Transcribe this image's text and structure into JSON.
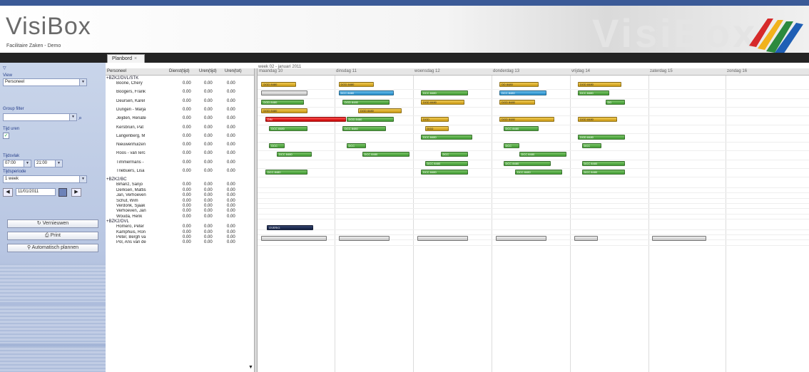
{
  "app": {
    "name": "VisiBox",
    "subtitle": "Facilitaire Zaken - Demo",
    "watermark": "VisiBox",
    "accent_color": "#3b5a97"
  },
  "tabs": [
    {
      "label": "Planbord",
      "close_icon": "close-icon"
    }
  ],
  "sidebar": {
    "view_label": "View",
    "view_value": "Personeel",
    "group_filter_label": "Group filter",
    "group_filter_value": "",
    "time_label": "Tijd uren",
    "time_range_label": "Tijdsvlak",
    "time_from": "07:00",
    "time_to": "21:00",
    "period_label": "Tijdsperiode",
    "period_value": "1 week",
    "date_value": "11/01/2011",
    "buttons": {
      "refresh": "Vernieuwen",
      "print": "Print",
      "auto_plan": "Automatisch plannen"
    }
  },
  "grid": {
    "week_title": "week 02 - januari 2011",
    "columns": [
      "Personeel",
      "Dienst(tijd)",
      "Uren(tijd)",
      "Uren(tot)"
    ],
    "days": [
      "maandag 10",
      "dinsdag 11",
      "woensdag 12",
      "donderdag 13",
      "vrijdag 14",
      "zaterdag 15",
      "zondag 16"
    ],
    "groups": [
      {
        "name": "BZK2/DVL/STK",
        "rows": [
          {
            "name": "Boone, Chery",
            "v": [
              "0.00",
              "0.00",
              "0.00"
            ]
          },
          {
            "name": "Boogers, Frank",
            "v": [
              "0.00",
              "0.00",
              "0.00"
            ]
          },
          {
            "name": "Deursen, Karel",
            "v": [
              "0.00",
              "0.00",
              "0.00"
            ]
          },
          {
            "name": "Dungen - Marja",
            "v": [
              "0.00",
              "0.00",
              "0.00"
            ]
          },
          {
            "name": "Jeijden, Renate",
            "v": [
              "0.00",
              "0.00",
              "0.00"
            ]
          },
          {
            "name": "Kersbruin, Pat",
            "v": [
              "0.00",
              "0.00",
              "0.00"
            ]
          },
          {
            "name": "Langenberg, M",
            "v": [
              "0.00",
              "0.00",
              "0.00"
            ]
          },
          {
            "name": "Nieuwenhuizen",
            "v": [
              "0.00",
              "0.00",
              "0.00"
            ]
          },
          {
            "name": "Roos - van Ierc",
            "v": [
              "0.00",
              "0.00",
              "0.00"
            ]
          },
          {
            "name": "Timmermans -",
            "v": [
              "0.00",
              "0.00",
              "0.00"
            ]
          },
          {
            "name": "Triebuers, Lisa",
            "v": [
              "0.00",
              "0.00",
              "0.00"
            ]
          }
        ]
      },
      {
        "name": "BZK2/BC",
        "rows": [
          {
            "name": "Bihariz, Sanjo",
            "v": [
              "0.00",
              "0.00",
              "0.00"
            ]
          },
          {
            "name": "Derksen, Mattis",
            "v": [
              "0.00",
              "0.00",
              "0.00"
            ]
          },
          {
            "name": "Jan, Verhoeven",
            "v": [
              "0.00",
              "0.00",
              "0.00"
            ]
          },
          {
            "name": "Schut, Wim",
            "v": [
              "0.00",
              "0.00",
              "0.00"
            ]
          },
          {
            "name": "Verdonk, Sjaak",
            "v": [
              "0.00",
              "0.00",
              "0.00"
            ]
          },
          {
            "name": "Verhoeven, Jan",
            "v": [
              "0.00",
              "0.00",
              "0.00"
            ]
          },
          {
            "name": "Wouda, Henk",
            "v": [
              "0.00",
              "0.00",
              "0.00"
            ]
          }
        ]
      },
      {
        "name": "BZK2/DVL",
        "rows": [
          {
            "name": "Homero, Peter",
            "v": [
              "0.00",
              "0.00",
              "0.00"
            ]
          },
          {
            "name": "Kamphuis, Ron",
            "v": [
              "0.00",
              "0.00",
              "0.00"
            ]
          },
          {
            "name": "Peter, Bergh va",
            "v": [
              "0.00",
              "0.00",
              "0.00"
            ]
          },
          {
            "name": "Pol, Ans van de",
            "v": [
              "0.00",
              "0.00",
              "0.00"
            ]
          }
        ]
      }
    ]
  },
  "bars": [
    {
      "row": 0,
      "day": 0.05,
      "w": 0.45,
      "c": "y",
      "t": "DGD  8480"
    },
    {
      "row": 0,
      "day": 1.05,
      "w": 0.45,
      "c": "y",
      "t": "DGD  8480"
    },
    {
      "row": 0,
      "day": 3.1,
      "w": 0.5,
      "c": "y",
      "t": "DD  8480"
    },
    {
      "row": 0,
      "day": 4.1,
      "w": 0.55,
      "c": "y",
      "t": "DGD  8480"
    },
    {
      "row": 1,
      "day": 0.05,
      "w": 0.6,
      "c": "e",
      "t": ""
    },
    {
      "row": 1,
      "day": 1.05,
      "w": 0.7,
      "c": "b",
      "t": "DCC  8480"
    },
    {
      "row": 1,
      "day": 2.1,
      "w": 0.6,
      "c": "g",
      "t": "DCC  8480"
    },
    {
      "row": 1,
      "day": 3.1,
      "w": 0.6,
      "c": "b",
      "t": "DCC  8480"
    },
    {
      "row": 1,
      "day": 4.1,
      "w": 0.4,
      "c": "g",
      "t": "DCC  8480"
    },
    {
      "row": 2,
      "day": 0.05,
      "w": 0.55,
      "c": "g",
      "t": "DGD  8480"
    },
    {
      "row": 2,
      "day": 1.1,
      "w": 0.6,
      "c": "g",
      "t": "DGD  8480"
    },
    {
      "row": 2,
      "day": 2.1,
      "w": 0.55,
      "c": "y",
      "t": "DGD  8480"
    },
    {
      "row": 2,
      "day": 3.1,
      "w": 0.45,
      "c": "y",
      "t": "DGD  8480"
    },
    {
      "row": 2,
      "day": 4.45,
      "w": 0.25,
      "c": "g",
      "t": "DD"
    },
    {
      "row": 3,
      "day": 0.05,
      "w": 0.6,
      "c": "y",
      "t": "DGD  8480"
    },
    {
      "row": 3,
      "day": 1.3,
      "w": 0.55,
      "c": "y",
      "t": "DGD  8480"
    },
    {
      "row": 4,
      "day": 0.1,
      "w": 1.05,
      "c": "r",
      "t": "DIN"
    },
    {
      "row": 4,
      "day": 1.15,
      "w": 0.6,
      "c": "g",
      "t": "DGD  8480"
    },
    {
      "row": 4,
      "day": 2.1,
      "w": 0.35,
      "c": "y",
      "t": "DGD"
    },
    {
      "row": 4,
      "day": 3.1,
      "w": 0.7,
      "c": "y",
      "t": "DGD  8480"
    },
    {
      "row": 4,
      "day": 4.1,
      "w": 0.5,
      "c": "y",
      "t": "DGD  8480"
    },
    {
      "row": 5,
      "day": 0.15,
      "w": 0.5,
      "c": "g",
      "t": "DCC  8480"
    },
    {
      "row": 5,
      "day": 1.1,
      "w": 0.55,
      "c": "g",
      "t": "DCC  8480"
    },
    {
      "row": 5,
      "day": 2.15,
      "w": 0.3,
      "c": "y",
      "t": "DGD"
    },
    {
      "row": 5,
      "day": 3.15,
      "w": 0.45,
      "c": "g",
      "t": "DCC  8480"
    },
    {
      "row": 6,
      "day": 2.1,
      "w": 0.65,
      "c": "g",
      "t": "DCC  8480"
    },
    {
      "row": 6,
      "day": 4.1,
      "w": 0.6,
      "c": "g",
      "t": "DGD  8480"
    },
    {
      "row": 7,
      "day": 0.15,
      "w": 0.2,
      "c": "g",
      "t": "DCC"
    },
    {
      "row": 7,
      "day": 1.15,
      "w": 0.25,
      "c": "g",
      "t": "DCC"
    },
    {
      "row": 7,
      "day": 3.15,
      "w": 0.2,
      "c": "g",
      "t": "DCC"
    },
    {
      "row": 7,
      "day": 4.15,
      "w": 0.25,
      "c": "g",
      "t": "DCC"
    },
    {
      "row": 8,
      "day": 0.25,
      "w": 0.45,
      "c": "g",
      "t": "DCC  8480"
    },
    {
      "row": 8,
      "day": 1.35,
      "w": 0.6,
      "c": "g",
      "t": "DCC  8480"
    },
    {
      "row": 8,
      "day": 2.35,
      "w": 0.35,
      "c": "g",
      "t": "DCC"
    },
    {
      "row": 8,
      "day": 3.35,
      "w": 0.6,
      "c": "g",
      "t": "DCC  8480"
    },
    {
      "row": 9,
      "day": 2.15,
      "w": 0.55,
      "c": "g",
      "t": "DCC  8480"
    },
    {
      "row": 9,
      "day": 3.15,
      "w": 0.6,
      "c": "g",
      "t": "DCC  8480"
    },
    {
      "row": 9,
      "day": 4.15,
      "w": 0.55,
      "c": "g",
      "t": "DCC  8480"
    },
    {
      "row": 10,
      "day": 0.1,
      "w": 0.55,
      "c": "g",
      "t": "DCC  8480"
    },
    {
      "row": 10,
      "day": 2.1,
      "w": 0.6,
      "c": "g",
      "t": "DCC  8480"
    },
    {
      "row": 10,
      "day": 3.3,
      "w": 0.6,
      "c": "g",
      "t": "DCC  8480"
    },
    {
      "row": 10,
      "day": 4.15,
      "w": 0.55,
      "c": "g",
      "t": "DCC  8480"
    },
    {
      "row": 18,
      "day": 0.12,
      "w": 0.6,
      "c": "n",
      "t": "OVERIG"
    },
    {
      "row": 20,
      "day": 0.05,
      "w": 0.85,
      "c": "e",
      "t": ""
    },
    {
      "row": 20,
      "day": 1.05,
      "w": 0.65,
      "c": "e",
      "t": ""
    },
    {
      "row": 20,
      "day": 2.05,
      "w": 0.65,
      "c": "e",
      "t": ""
    },
    {
      "row": 20,
      "day": 3.05,
      "w": 0.65,
      "c": "e",
      "t": ""
    },
    {
      "row": 20,
      "day": 4.05,
      "w": 0.3,
      "c": "e",
      "t": ""
    },
    {
      "row": 20,
      "day": 5.05,
      "w": 0.7,
      "c": "e",
      "t": ""
    }
  ]
}
